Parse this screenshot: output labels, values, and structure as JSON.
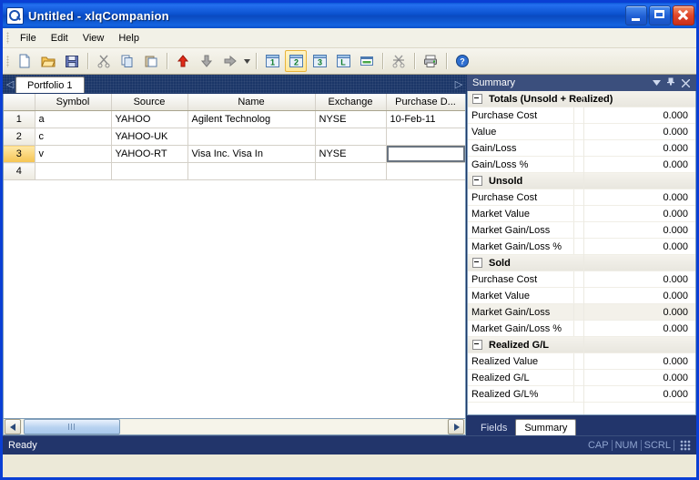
{
  "window": {
    "title": "Untitled - xlqCompanion",
    "icon": "app-magnifier-icon",
    "minimize_label": "Minimize",
    "maximize_label": "Maximize",
    "close_label": "Close"
  },
  "menu": {
    "items": [
      {
        "label": "File"
      },
      {
        "label": "Edit"
      },
      {
        "label": "View"
      },
      {
        "label": "Help"
      }
    ]
  },
  "toolbar": {
    "buttons": [
      {
        "name": "new-icon",
        "label": "New"
      },
      {
        "name": "open-icon",
        "label": "Open"
      },
      {
        "name": "save-icon",
        "label": "Save"
      },
      {
        "name": "cut-icon",
        "label": "Cut"
      },
      {
        "name": "copy-icon",
        "label": "Copy"
      },
      {
        "name": "paste-icon",
        "label": "Paste"
      },
      {
        "name": "arrow-up-icon",
        "label": "Move Up"
      },
      {
        "name": "arrow-down-icon",
        "label": "Move Down"
      },
      {
        "name": "arrow-right-icon",
        "label": "Move Right"
      },
      {
        "name": "layout-1-icon",
        "label": "1"
      },
      {
        "name": "layout-2-icon",
        "label": "2"
      },
      {
        "name": "layout-3-icon",
        "label": "3"
      },
      {
        "name": "layout-l-icon",
        "label": "L"
      },
      {
        "name": "properties-icon",
        "label": "Properties"
      },
      {
        "name": "clear-icon",
        "label": "Clear"
      },
      {
        "name": "print-icon",
        "label": "Print"
      },
      {
        "name": "help-icon",
        "label": "Help"
      }
    ],
    "active_layout": "2"
  },
  "document_tabs": {
    "nav_left": "◁",
    "nav_right": "▷",
    "tabs": [
      {
        "label": "Portfolio 1",
        "active": true
      }
    ]
  },
  "grid": {
    "columns": [
      "Symbol",
      "Source",
      "Name",
      "Exchange",
      "Purchase D..."
    ],
    "active_column": "Purchase D...",
    "current_row": 3,
    "selected_cell": {
      "row": 3,
      "column": "Purchase D..."
    },
    "rows": [
      {
        "num": "1",
        "Symbol": "a",
        "Source": "YAHOO",
        "Name": "Agilent Technolog",
        "Exchange": "NYSE",
        "Purchase": "10-Feb-11"
      },
      {
        "num": "2",
        "Symbol": "c",
        "Source": "YAHOO-UK",
        "Name": "",
        "Exchange": "",
        "Purchase": ""
      },
      {
        "num": "3",
        "Symbol": "v",
        "Source": "YAHOO-RT",
        "Name": "Visa Inc. Visa In",
        "Exchange": "NYSE",
        "Purchase": ""
      },
      {
        "num": "4",
        "Symbol": "",
        "Source": "",
        "Name": "",
        "Exchange": "",
        "Purchase": ""
      }
    ]
  },
  "summary_panel": {
    "title": "Summary",
    "header_icons": [
      {
        "name": "chevron-down-icon",
        "glyph": "▼"
      },
      {
        "name": "pin-icon",
        "glyph": "⚕"
      },
      {
        "name": "close-icon",
        "glyph": "✕"
      }
    ],
    "groups": [
      {
        "title": "Totals (Unsold + Realized)",
        "rows": [
          {
            "label": "Purchase Cost",
            "value": "0.000"
          },
          {
            "label": "Value",
            "value": "0.000"
          },
          {
            "label": "Gain/Loss",
            "value": "0.000"
          },
          {
            "label": "Gain/Loss %",
            "value": "0.000"
          }
        ]
      },
      {
        "title": "Unsold",
        "rows": [
          {
            "label": "Purchase Cost",
            "value": "0.000"
          },
          {
            "label": "Market Value",
            "value": "0.000"
          },
          {
            "label": "Market Gain/Loss",
            "value": "0.000"
          },
          {
            "label": "Market Gain/Loss %",
            "value": "0.000"
          }
        ]
      },
      {
        "title": "Sold",
        "rows": [
          {
            "label": "Purchase Cost",
            "value": "0.000"
          },
          {
            "label": "Market Value",
            "value": "0.000"
          },
          {
            "label": "Market Gain/Loss",
            "value": "0.000",
            "hover": true
          },
          {
            "label": "Market Gain/Loss %",
            "value": "0.000"
          }
        ]
      },
      {
        "title": "Realized G/L",
        "rows": [
          {
            "label": "Realized Value",
            "value": "0.000"
          },
          {
            "label": "Realized G/L",
            "value": "0.000"
          },
          {
            "label": "Realized G/L%",
            "value": "0.000"
          }
        ]
      }
    ],
    "bottom_tabs": [
      {
        "label": "Fields",
        "active": false
      },
      {
        "label": "Summary",
        "active": true
      }
    ]
  },
  "scrollbar": {
    "left_arrow": "◀",
    "right_arrow": "▶"
  },
  "statusbar": {
    "message": "Ready",
    "indicators": [
      "CAP",
      "NUM",
      "SCRL"
    ]
  },
  "colors": {
    "title_blue": "#0a4ac0",
    "accent_amber": "#f5c451",
    "panel_navy": "#22356b",
    "grid_line": "#d4d0c8"
  }
}
